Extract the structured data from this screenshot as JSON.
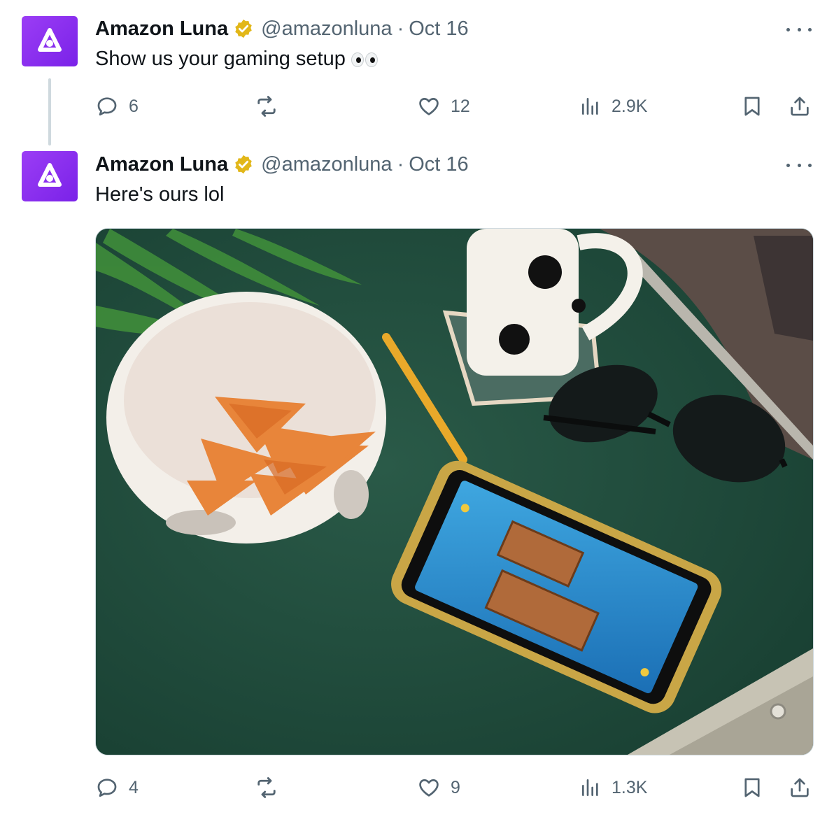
{
  "tweets": [
    {
      "author_name": "Amazon Luna",
      "handle": "@amazonluna",
      "separator": "·",
      "date": "Oct 16",
      "text": "Show us your gaming setup",
      "emoji": "eyes",
      "stats": {
        "replies": "6",
        "reposts": "",
        "likes": "12",
        "views": "2.9K"
      }
    },
    {
      "author_name": "Amazon Luna",
      "handle": "@amazonluna",
      "separator": "·",
      "date": "Oct 16",
      "text": "Here's ours lol",
      "stats": {
        "replies": "4",
        "reposts": "",
        "likes": "9",
        "views": "1.3K"
      }
    }
  ],
  "icons": {
    "avatar": "amazon-luna-logo",
    "verified": "verified-badge",
    "more": "more-icon",
    "reply": "reply-icon",
    "repost": "repost-icon",
    "like": "heart-icon",
    "views": "views-icon",
    "bookmark": "bookmark-icon",
    "share": "share-icon"
  },
  "colors": {
    "avatar_bg": "#8b2ff0",
    "verified": "#e2b719",
    "text": "#0f1419",
    "muted": "#536471"
  }
}
